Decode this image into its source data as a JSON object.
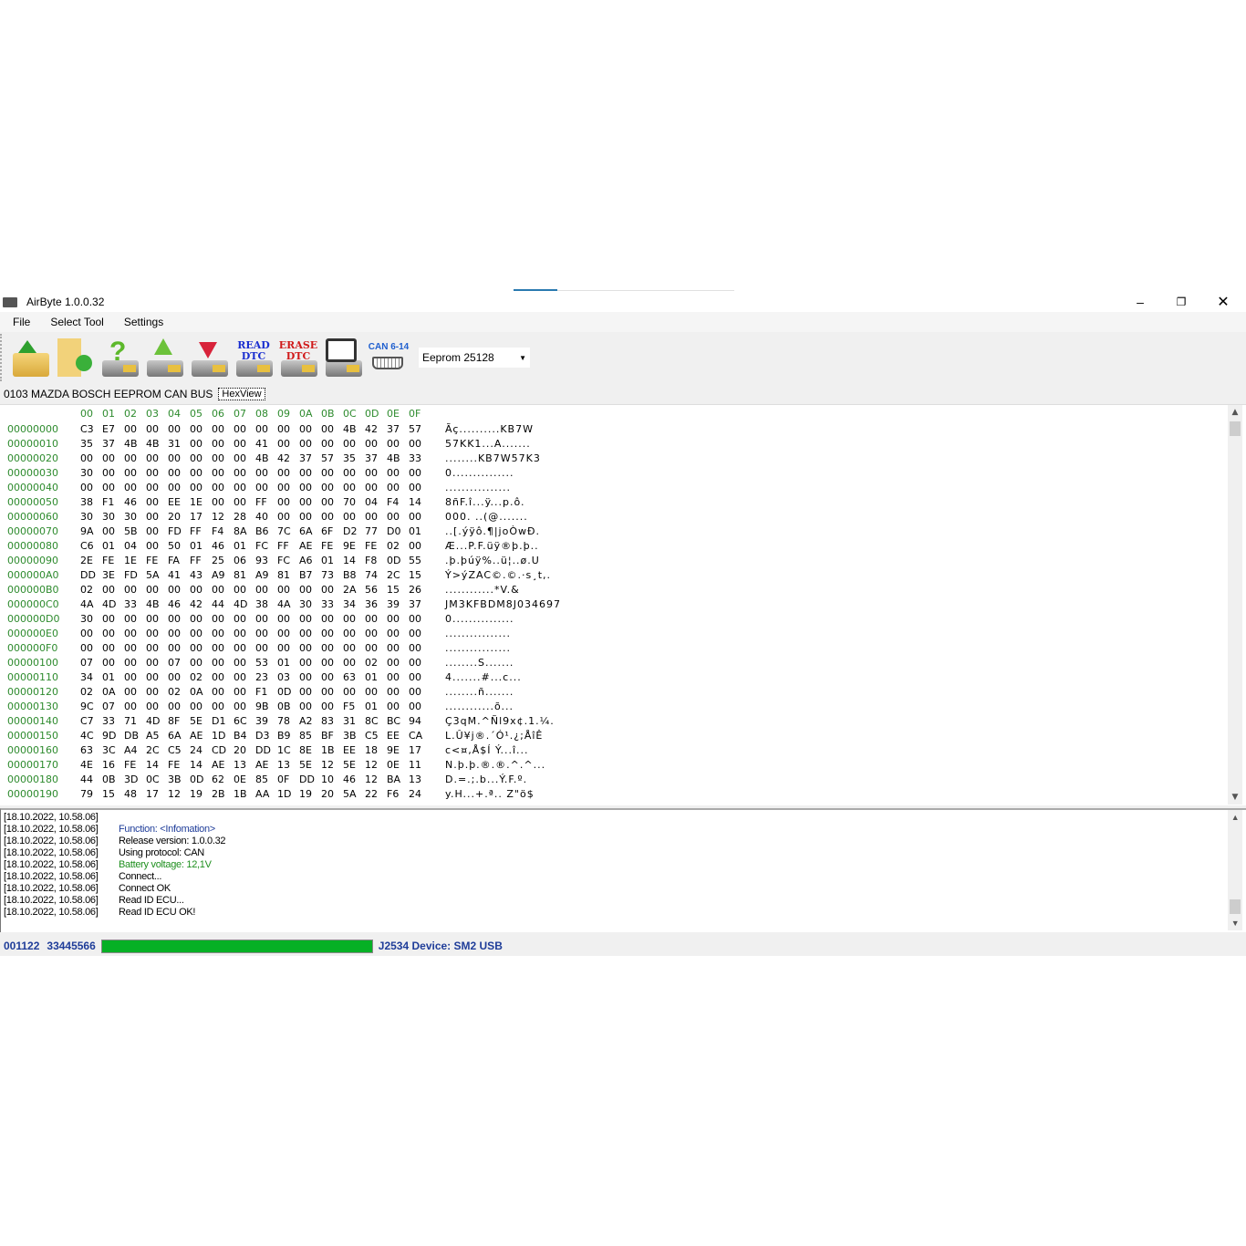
{
  "window": {
    "title": "AirByte  1.0.0.32"
  },
  "menu": [
    "File",
    "Select Tool",
    "Settings"
  ],
  "toolbar": {
    "buttons": [
      {
        "name": "open-file",
        "icon": "folder-up-icon"
      },
      {
        "name": "save-file",
        "icon": "folder-arrow-icon"
      },
      {
        "name": "identify-ecu",
        "icon": "question-ecu-icon"
      },
      {
        "name": "write-ecu",
        "icon": "upload-ecu-icon"
      },
      {
        "name": "read-ecu",
        "icon": "download-ecu-icon"
      },
      {
        "name": "read-dtc",
        "icon": "ecu-icon",
        "label1": "READ",
        "label2": "DTC",
        "color": "#1a2fd0"
      },
      {
        "name": "erase-dtc",
        "icon": "ecu-icon",
        "label1": "ERASE",
        "label2": "DTC",
        "color": "#d01a1a"
      },
      {
        "name": "manual",
        "icon": "book-hand-icon"
      }
    ],
    "connector_label": "CAN 6-14",
    "chip_select": "Eeprom 25128"
  },
  "tabs": {
    "module": "0103 MAZDA BOSCH EEPROM CAN BUS",
    "hexview": "HexView"
  },
  "hex": {
    "columns": [
      "00",
      "01",
      "02",
      "03",
      "04",
      "05",
      "06",
      "07",
      "08",
      "09",
      "0A",
      "0B",
      "0C",
      "0D",
      "0E",
      "0F"
    ],
    "rows": [
      {
        "addr": "00000000",
        "hex": "C3 E7 00 00 00 00 00 00 00 00 00 00 4B 42 37 57",
        "ascii": "Ãç..........KB7W"
      },
      {
        "addr": "00000010",
        "hex": "35 37 4B 4B 31 00 00 00 41 00 00 00 00 00 00 00",
        "ascii": "57KK1...A......."
      },
      {
        "addr": "00000020",
        "hex": "00 00 00 00 00 00 00 00 4B 42 37 57 35 37 4B 33",
        "ascii": "........KB7W57K3"
      },
      {
        "addr": "00000030",
        "hex": "30 00 00 00 00 00 00 00 00 00 00 00 00 00 00 00",
        "ascii": "0..............."
      },
      {
        "addr": "00000040",
        "hex": "00 00 00 00 00 00 00 00 00 00 00 00 00 00 00 00",
        "ascii": "................"
      },
      {
        "addr": "00000050",
        "hex": "38 F1 46 00 EE 1E 00 00 FF 00 00 00 70 04 F4 14",
        "ascii": "8ñF.î...ÿ...p.ô."
      },
      {
        "addr": "00000060",
        "hex": "30 30 30 00 20 17 12 28 40 00 00 00 00 00 00 00",
        "ascii": "000. ..(@......."
      },
      {
        "addr": "00000070",
        "hex": "9A 00 5B 00 FD FF F4 8A B6 7C 6A 6F D2 77 D0 01",
        "ascii": "..[.ýÿô.¶|joÒwÐ."
      },
      {
        "addr": "00000080",
        "hex": "C6 01 04 00 50 01 46 01 FC FF AE FE 9E FE 02 00",
        "ascii": "Æ...P.F.üÿ®þ.þ.."
      },
      {
        "addr": "00000090",
        "hex": "2E FE 1E FE FA FF 25 06 93 FC A6 01 14 F8 0D 55",
        "ascii": ".þ.þúÿ%..ü¦..ø.U"
      },
      {
        "addr": "000000A0",
        "hex": "DD 3E FD 5A 41 43 A9 81 A9 81 B7 73 B8 74 2C 15",
        "ascii": "Ý>ýZAC©.©.·s¸t,."
      },
      {
        "addr": "000000B0",
        "hex": "02 00 00 00 00 00 00 00 00 00 00 00 2A 56 15 26",
        "ascii": "............*V.&"
      },
      {
        "addr": "000000C0",
        "hex": "4A 4D 33 4B 46 42 44 4D 38 4A 30 33 34 36 39 37",
        "ascii": "JM3KFBDM8J034697"
      },
      {
        "addr": "000000D0",
        "hex": "30 00 00 00 00 00 00 00 00 00 00 00 00 00 00 00",
        "ascii": "0..............."
      },
      {
        "addr": "000000E0",
        "hex": "00 00 00 00 00 00 00 00 00 00 00 00 00 00 00 00",
        "ascii": "................"
      },
      {
        "addr": "000000F0",
        "hex": "00 00 00 00 00 00 00 00 00 00 00 00 00 00 00 00",
        "ascii": "................"
      },
      {
        "addr": "00000100",
        "hex": "07 00 00 00 07 00 00 00 53 01 00 00 00 02 00 00",
        "ascii": "........S......."
      },
      {
        "addr": "00000110",
        "hex": "34 01 00 00 00 02 00 00 23 03 00 00 63 01 00 00",
        "ascii": "4.......#...c..."
      },
      {
        "addr": "00000120",
        "hex": "02 0A 00 00 02 0A 00 00 F1 0D 00 00 00 00 00 00",
        "ascii": "........ñ......."
      },
      {
        "addr": "00000130",
        "hex": "9C 07 00 00 00 00 00 00 9B 0B 00 00 F5 01 00 00",
        "ascii": "............õ..."
      },
      {
        "addr": "00000140",
        "hex": "C7 33 71 4D 8F 5E D1 6C 39 78 A2 83 31 8C BC 94",
        "ascii": "Ç3qM.^Ñl9x¢.1.¼."
      },
      {
        "addr": "00000150",
        "hex": "4C 9D DB A5 6A AE 1D B4 D3 B9 85 BF 3B C5 EE CA",
        "ascii": "L.Û¥j®.´Ó¹.¿;ÅîÊ"
      },
      {
        "addr": "00000160",
        "hex": "63 3C A4 2C C5 24 CD 20 DD 1C 8E 1B EE 18 9E 17",
        "ascii": "c<¤,Å$Í Ý...î..."
      },
      {
        "addr": "00000170",
        "hex": "4E 16 FE 14 FE 14 AE 13 AE 13 5E 12 5E 12 0E 11",
        "ascii": "N.þ.þ.®.®.^.^..."
      },
      {
        "addr": "00000180",
        "hex": "44 0B 3D 0C 3B 0D 62 0E 85 0F DD 10 46 12 BA 13",
        "ascii": "D.=.;.b...Ý.F.º."
      },
      {
        "addr": "00000190",
        "hex": "79 15 48 17 12 19 2B 1B AA 1D 19 20 5A 22 F6 24",
        "ascii": "y.H...+.ª.. Z\"ö$"
      }
    ]
  },
  "log": [
    {
      "time": "[18.10.2022, 10.58.06]",
      "msg": "",
      "color": "#000000"
    },
    {
      "time": "[18.10.2022, 10.58.06]",
      "msg": "Function: <Infomation>",
      "color": "#1f3d99"
    },
    {
      "time": "[18.10.2022, 10.58.06]",
      "msg": "Release version: 1.0.0.32",
      "color": "#000000"
    },
    {
      "time": "[18.10.2022, 10.58.06]",
      "msg": "Using protocol: CAN",
      "color": "#000000"
    },
    {
      "time": "[18.10.2022, 10.58.06]",
      "msg": "Battery voltage: 12,1V",
      "color": "#1e8f1e"
    },
    {
      "time": "[18.10.2022, 10.58.06]",
      "msg": "Connect...",
      "color": "#000000"
    },
    {
      "time": "[18.10.2022, 10.58.06]",
      "msg": "Connect OK",
      "color": "#000000"
    },
    {
      "time": "[18.10.2022, 10.58.06]",
      "msg": "Read ID ECU...",
      "color": "#000000"
    },
    {
      "time": "[18.10.2022, 10.58.06]",
      "msg": "Read ID ECU OK!",
      "color": "#000000"
    }
  ],
  "status": {
    "code1": "001122",
    "code2": "33445566",
    "progress_percent": 100,
    "device": "J2534 Device: SM2 USB",
    "progress_color": "#06b025"
  }
}
